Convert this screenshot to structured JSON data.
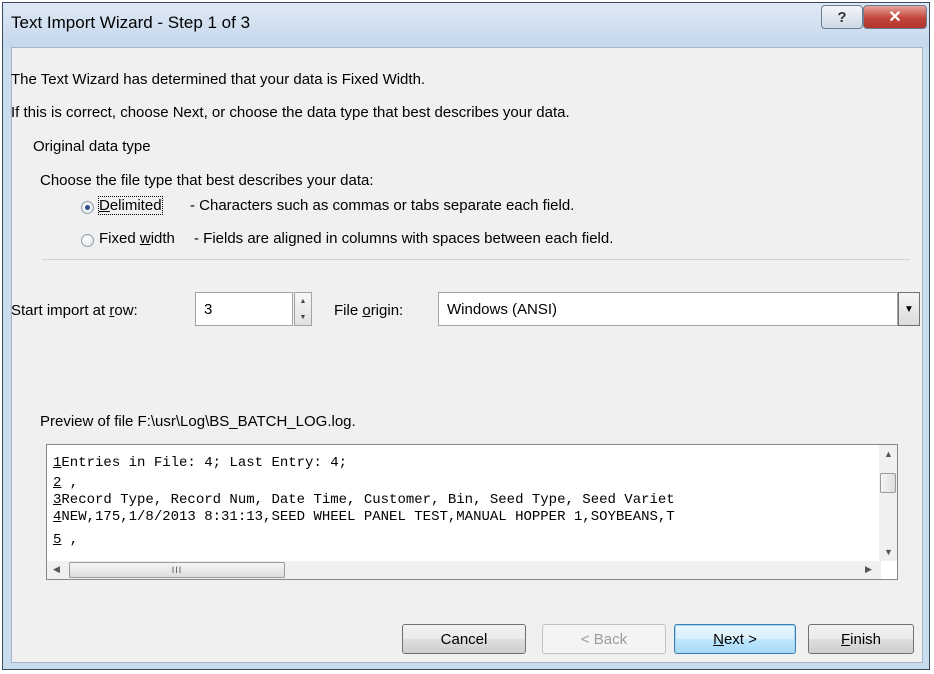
{
  "window": {
    "title": "Text Import Wizard - Step 1 of 3",
    "help_glyph": "?",
    "close_glyph": "✕"
  },
  "intro": {
    "line1": "The Text Wizard has determined that your data is Fixed Width.",
    "line2": "If this is correct, choose Next, or choose the data type that best describes your data."
  },
  "original_data_type": {
    "group_label": "Original data type",
    "prompt": "Choose the file type that best describes your data:",
    "options": [
      {
        "label_pre": "",
        "label_key": "D",
        "label_post": "elimited",
        "description": "- Characters such as commas or tabs separate each field.",
        "selected": true
      },
      {
        "label_pre": "Fixed ",
        "label_key": "w",
        "label_post": "idth",
        "description": "- Fields are aligned in columns with spaces between each field.",
        "selected": false
      }
    ]
  },
  "start_row": {
    "label_pre": "Start import at ",
    "label_key": "r",
    "label_post": "ow:",
    "value": "3"
  },
  "file_origin": {
    "label_pre": "File ",
    "label_key": "o",
    "label_post": "rigin:",
    "value": "Windows (ANSI)"
  },
  "preview": {
    "label": "Preview of file F:\\usr\\Log\\BS_BATCH_LOG.log.",
    "lines": [
      {
        "num": "1",
        "text": "Entries in File: 4; Last Entry: 4;"
      },
      {
        "num": "2",
        "text": " ,"
      },
      {
        "num": "3",
        "text": "Record Type, Record Num, Date Time, Customer, Bin, Seed Type, Seed Variet"
      },
      {
        "num": "4",
        "text": "NEW,175,1/8/2013 8:31:13,SEED WHEEL PANEL TEST,MANUAL HOPPER 1,SOYBEANS,T"
      },
      {
        "num": "5",
        "text": " ,"
      }
    ],
    "hthumb_grip": "III"
  },
  "buttons": {
    "cancel": "Cancel",
    "back": "< Back",
    "next_key": "N",
    "next_rest": "ext >",
    "finish_key": "F",
    "finish_rest": "inish"
  }
}
